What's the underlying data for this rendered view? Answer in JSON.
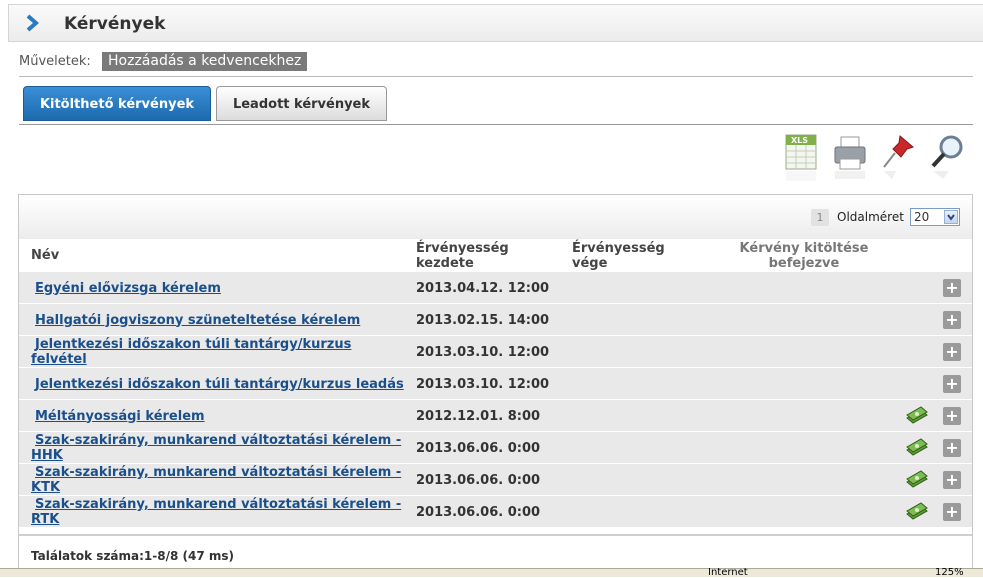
{
  "header": {
    "title": "Kérvények"
  },
  "actions": {
    "label": "Műveletek:",
    "add_favorite": "Hozzáadás a kedvencekhez"
  },
  "tabs": [
    {
      "label": "Kitölthető kérvények",
      "active": true
    },
    {
      "label": "Leadott kérvények",
      "active": false
    }
  ],
  "toolbar": {
    "icons": [
      "excel-export-icon",
      "print-icon",
      "pin-icon",
      "search-icon"
    ],
    "xls_text": "XLS"
  },
  "pager": {
    "current_page": "1",
    "page_size_label": "Oldalméret",
    "page_size": "20"
  },
  "table": {
    "columns": {
      "name": "Név",
      "start": "Érvényesség kezdete",
      "end": "Érvényesség vége",
      "finished": "Kérvény kitöltése befejezve"
    },
    "rows": [
      {
        "name": "Egyéni elővizsga kérelem",
        "start": "2013.04.12. 12:00",
        "end": "",
        "payment": false
      },
      {
        "name": "Hallgatói jogviszony szüneteltetése kérelem",
        "start": "2013.02.15. 14:00",
        "end": "",
        "payment": false
      },
      {
        "name": "Jelentkezési időszakon túli tantárgy/kurzus felvétel",
        "start": "2013.03.10. 12:00",
        "end": "",
        "payment": false
      },
      {
        "name": "Jelentkezési időszakon túli tantárgy/kurzus leadás",
        "start": "2013.03.10. 12:00",
        "end": "",
        "payment": false
      },
      {
        "name": "Méltányossági kérelem",
        "start": "2012.12.01. 8:00",
        "end": "",
        "payment": true
      },
      {
        "name": "Szak-szakirány, munkarend változtatási kérelem - HHK",
        "start": "2013.06.06. 0:00",
        "end": "",
        "payment": true
      },
      {
        "name": "Szak-szakirány, munkarend változtatási kérelem - KTK",
        "start": "2013.06.06. 0:00",
        "end": "",
        "payment": true
      },
      {
        "name": "Szak-szakirány, munkarend változtatási kérelem - RTK",
        "start": "2013.06.06. 0:00",
        "end": "",
        "payment": true
      }
    ],
    "plus_symbol": "+"
  },
  "results": "Találatok száma:1-8/8 (47 ms)",
  "statusbar": {
    "zone": "Internet",
    "zoom": "125%"
  }
}
